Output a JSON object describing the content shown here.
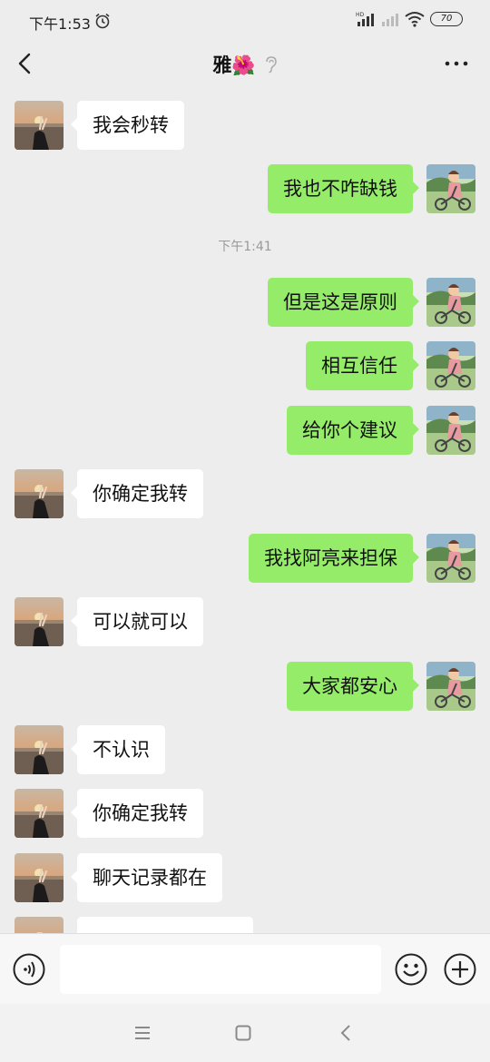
{
  "status_bar": {
    "time": "下午1:53",
    "battery": "70",
    "icons": [
      "alarm-icon",
      "hd-signal-icon",
      "signal-icon",
      "wifi-icon",
      "battery-icon"
    ]
  },
  "header": {
    "title": "雅🌺",
    "icons": [
      "back-icon",
      "ear-icon",
      "more-icon"
    ]
  },
  "messages": [
    {
      "side": "in",
      "text": "我会秒转"
    },
    {
      "side": "out",
      "text": "我也不咋缺钱"
    },
    {
      "type": "time",
      "text": "下午1:41"
    },
    {
      "side": "out",
      "text": "但是这是原则"
    },
    {
      "side": "out",
      "text": "相互信任"
    },
    {
      "side": "out",
      "text": "给你个建议"
    },
    {
      "side": "in",
      "text": "你确定我转"
    },
    {
      "side": "out",
      "text": "我找阿亮来担保"
    },
    {
      "side": "in",
      "text": "可以就可以"
    },
    {
      "side": "out",
      "text": "大家都安心"
    },
    {
      "side": "in",
      "text": "不认识"
    },
    {
      "side": "in",
      "text": "你确定我转"
    },
    {
      "side": "in",
      "text": "聊天记录都在"
    },
    {
      "side": "in",
      "text": ""
    }
  ],
  "input_bar": {
    "value": "",
    "placeholder": "",
    "icons": [
      "voice-icon",
      "emoji-icon",
      "plus-icon"
    ]
  },
  "nav_bar": {
    "icons": [
      "menu-icon",
      "home-icon",
      "nav-back-icon"
    ]
  },
  "colors": {
    "background": "#ededed",
    "outgoing_bubble": "#95ec69",
    "incoming_bubble": "#ffffff"
  }
}
